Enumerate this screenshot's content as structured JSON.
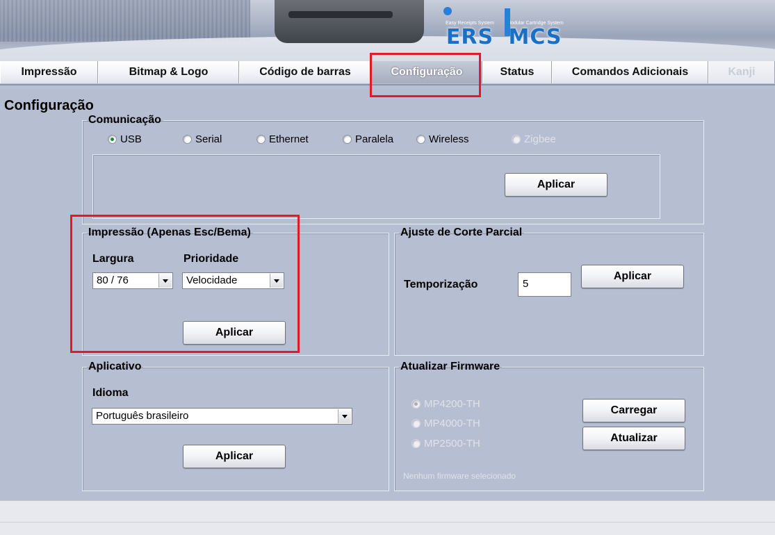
{
  "banner": {
    "ers": {
      "top": "Easy Receipts System",
      "main": "ERS"
    },
    "mcs": {
      "top": "Modular Cartridge System",
      "main": "MCS"
    }
  },
  "tabs": [
    {
      "label": "Impressão",
      "state": "normal"
    },
    {
      "label": "Bitmap & Logo",
      "state": "normal"
    },
    {
      "label": "Código de barras",
      "state": "normal"
    },
    {
      "label": "Configuração",
      "state": "active"
    },
    {
      "label": "Status",
      "state": "normal"
    },
    {
      "label": "Comandos Adicionais",
      "state": "normal"
    },
    {
      "label": "Kanji",
      "state": "disabled"
    }
  ],
  "page_title": "Configuração",
  "comunicacao": {
    "legend": "Comunicação",
    "options": [
      {
        "label": "USB",
        "checked": true,
        "enabled": true
      },
      {
        "label": "Serial",
        "checked": false,
        "enabled": true
      },
      {
        "label": "Ethernet",
        "checked": false,
        "enabled": true
      },
      {
        "label": "Paralela",
        "checked": false,
        "enabled": true
      },
      {
        "label": "Wireless",
        "checked": false,
        "enabled": true
      },
      {
        "label": "Zigbee",
        "checked": false,
        "enabled": false
      }
    ],
    "apply_label": "Aplicar"
  },
  "impressao": {
    "legend": "Impressão (Apenas Esc/Bema)",
    "largura_label": "Largura",
    "largura_value": "80 / 76",
    "prioridade_label": "Prioridade",
    "prioridade_value": "Velocidade",
    "apply_label": "Aplicar"
  },
  "corte": {
    "legend": "Ajuste de Corte Parcial",
    "temporizacao_label": "Temporização",
    "temporizacao_value": "5",
    "apply_label": "Aplicar"
  },
  "aplicativo": {
    "legend": "Aplicativo",
    "idioma_label": "Idioma",
    "idioma_value": "Português brasileiro",
    "apply_label": "Aplicar"
  },
  "firmware": {
    "legend": "Atualizar Firmware",
    "models": [
      {
        "label": "MP4200-TH",
        "checked": true
      },
      {
        "label": "MP4000-TH",
        "checked": false
      },
      {
        "label": "MP2500-TH",
        "checked": false
      }
    ],
    "load_label": "Carregar",
    "update_label": "Atualizar",
    "note": "Nenhum firmware selecionado"
  },
  "colors": {
    "background": "#b6bfd1",
    "highlight": "#e3182a",
    "logo_blue": "#1d6fc4"
  }
}
